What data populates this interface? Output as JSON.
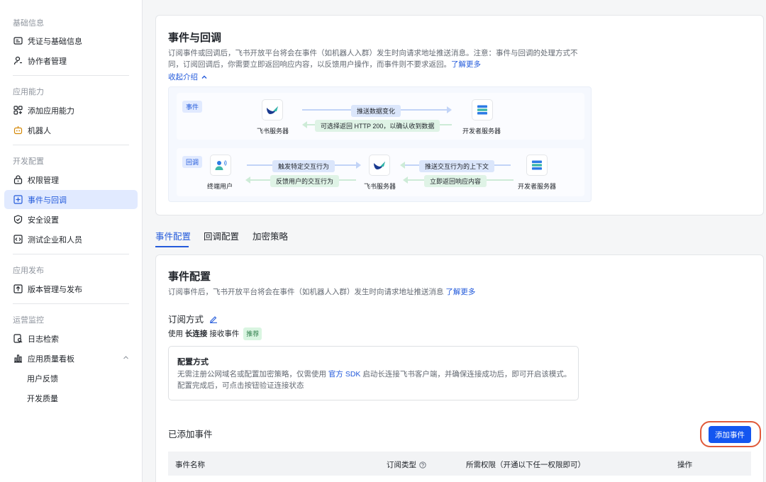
{
  "sidebar": {
    "groups": [
      {
        "title": "基础信息",
        "items": [
          "凭证与基础信息",
          "协作者管理"
        ]
      },
      {
        "title": "应用能力",
        "items": [
          "添加应用能力",
          "机器人"
        ]
      },
      {
        "title": "开发配置",
        "items": [
          "权限管理",
          "事件与回调",
          "安全设置",
          "测试企业和人员"
        ]
      },
      {
        "title": "应用发布",
        "items": [
          "版本管理与发布"
        ]
      },
      {
        "title": "运营监控",
        "items": [
          "日志检索",
          "应用质量看板",
          "用户反馈",
          "开发质量"
        ]
      }
    ]
  },
  "intro": {
    "title": "事件与回调",
    "desc_line1": "订阅事件或回调后，飞书开放平台将会在事件（如机器人入群）发生时向请求地址推送消息。注意：事件与回调的处理方式不",
    "desc_line2": "同，订阅回调后，你需要立即返回响应内容，以反馈用户操作，而事件则不要求返回。",
    "learn_more": "了解更多",
    "collapse": "收起介绍"
  },
  "flow": {
    "event_tag": "事件",
    "callback_tag": "回调",
    "feishu_server": "飞书服务器",
    "dev_server": "开发者服务器",
    "end_user": "终端用户",
    "push_change": "推送数据变化",
    "optional_return": "可选择返回 HTTP 200，以确认收到数据",
    "trigger": "触发特定交互行为",
    "feedback": "反馈用户的交互行为",
    "push_context": "推送交互行为的上下文",
    "return_now": "立即返回响应内容"
  },
  "tabs": [
    "事件配置",
    "回调配置",
    "加密策略"
  ],
  "event_config": {
    "title": "事件配置",
    "desc": "订阅事件后，飞书开放平台将会在事件（如机器人入群）发生时向请求地址推送消息",
    "learn_more": "了解更多",
    "sub_method_title": "订阅方式",
    "use_prefix": "使用",
    "use_method": "长连接",
    "use_suffix": "接收事件",
    "recommend": "推荐",
    "config_title": "配置方式",
    "config_line1a": "无需注册公网域名或配置加密策略，仅需使用",
    "config_sdk": "官方 SDK",
    "config_line1b": "启动长连接飞书客户端，并确保连接成功后，即可开启该模式。",
    "config_line2": "配置完成后，可点击按钮验证连接状态",
    "added_title": "已添加事件",
    "add_button": "添加事件",
    "columns": [
      "事件名称",
      "订阅类型",
      "所需权限（开通以下任一权限即可）",
      "操作"
    ]
  },
  "colors": {
    "accent": "#245bdb",
    "primary_button": "#1456f0",
    "highlight": "#e05a3a"
  }
}
